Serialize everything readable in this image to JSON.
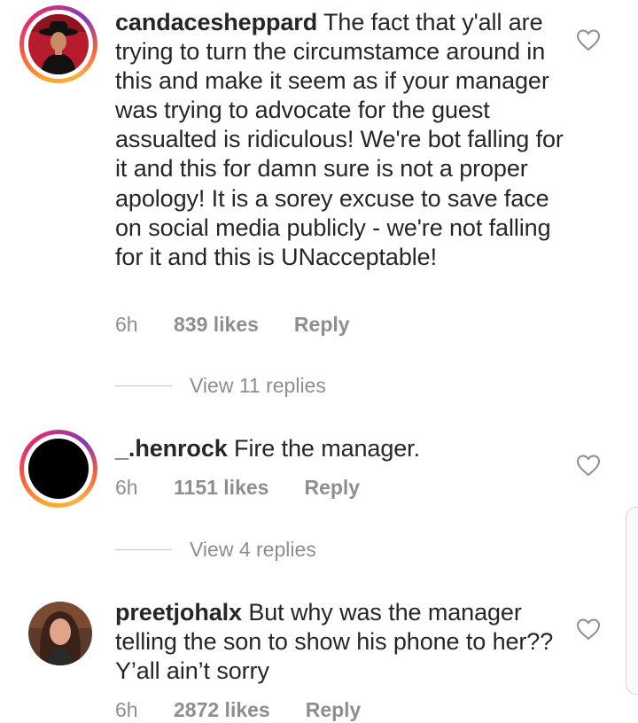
{
  "comments": [
    {
      "username": "candacesheppard",
      "text": " The fact that y'all are trying to turn the circumstamce around in this and make it seem as if your manager was trying to advocate for the guest assualted is ridiculous! We're bot falling for it and this for damn sure is not a proper apology! It is a sorey excuse to save face on social media publicly - we're not falling for it and this is UNacceptable!",
      "time": "6h",
      "likes": "839 likes",
      "reply": "Reply",
      "view_replies": "View 11 replies",
      "avatar_ring": true
    },
    {
      "username": "_.henrock",
      "text": " Fire the manager.",
      "time": "6h",
      "likes": "1151 likes",
      "reply": "Reply",
      "view_replies": "View 4 replies",
      "avatar_ring": true
    },
    {
      "username": "preetjohalx",
      "text": " But why was the manager telling the son to show his phone to her?? Y’all ain’t sorry",
      "time": "6h",
      "likes": "2872 likes",
      "reply": "Reply",
      "avatar_ring": false
    }
  ],
  "icons": {
    "like": "heart-outline-icon"
  },
  "colors": {
    "text": "#262626",
    "secondary": "#8e8e8e",
    "ring_gradient": [
      "#f9a825",
      "#e1306c",
      "#833ab4"
    ]
  }
}
